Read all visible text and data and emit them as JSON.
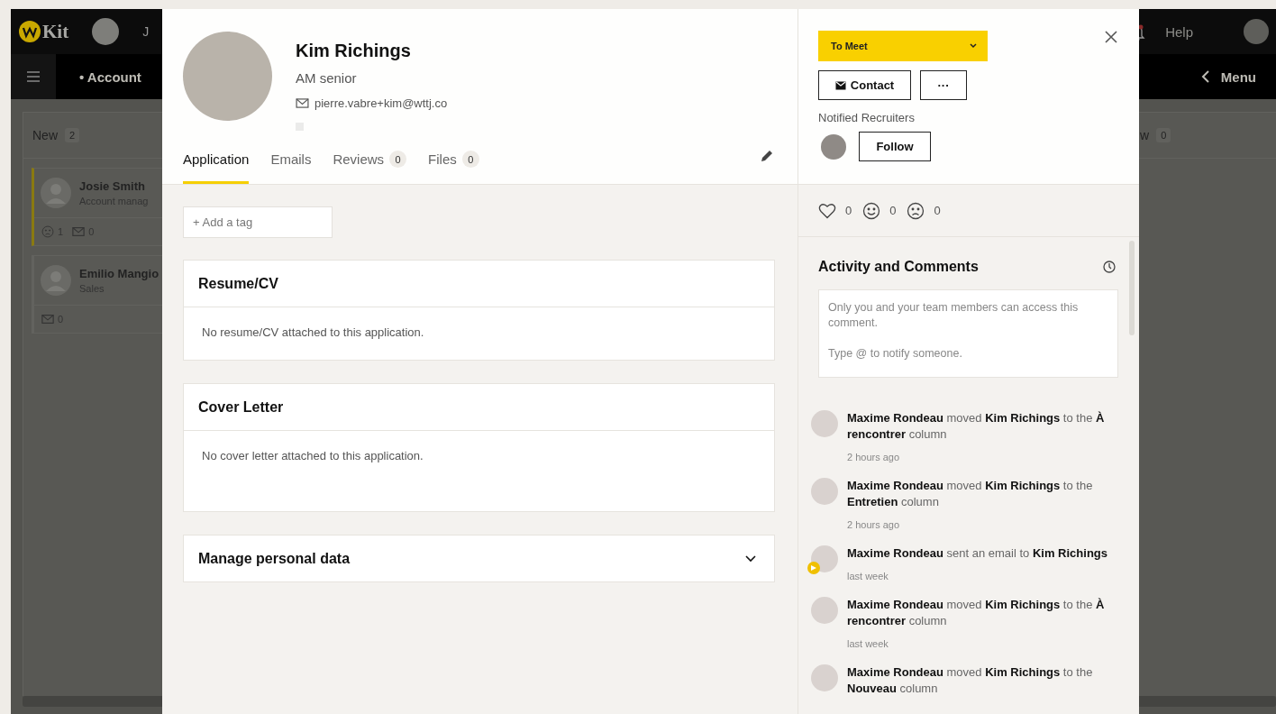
{
  "background_app": {
    "logo": "Kit",
    "nav_partial": "J",
    "help": "Help",
    "section_title": "• Account",
    "menu": "Menu",
    "columns": [
      {
        "title": "New",
        "count": "2",
        "cards": [
          {
            "name": "Josie Smith",
            "role": "Account manag",
            "highlighted": true,
            "stats": [
              {
                "kind": "sad",
                "count": "1"
              },
              {
                "kind": "mail",
                "count": "0"
              }
            ]
          },
          {
            "name": "Emilio Mangio",
            "role": "Sales",
            "highlighted": false,
            "stats": [
              {
                "kind": "mail",
                "count": "0"
              }
            ]
          }
        ]
      },
      {
        "title": "w",
        "count": "0"
      }
    ]
  },
  "candidate": {
    "name": "Kim Richings",
    "role": "AM senior",
    "email": "pierre.vabre+kim@wttj.co"
  },
  "tabs": [
    {
      "label": "Application",
      "selected": true
    },
    {
      "label": "Emails",
      "selected": false
    },
    {
      "label": "Reviews",
      "count": "0",
      "selected": false
    },
    {
      "label": "Files",
      "count": "0",
      "selected": false
    }
  ],
  "tag_field": {
    "placeholder": "+ Add a tag"
  },
  "sections": [
    {
      "kind": "panel",
      "title": "Resume/CV",
      "body": "No resume/CV attached to this application."
    },
    {
      "kind": "panel",
      "title": "Cover Letter",
      "body": "No cover letter attached to this application."
    },
    {
      "kind": "collapsible",
      "title": "Manage personal data",
      "expanded": false
    }
  ],
  "status_dropdown": {
    "value": "To Meet"
  },
  "actions": {
    "contact": "Contact",
    "more": "···"
  },
  "notified_recruiters": {
    "label": "Notified Recruiters",
    "follow": "Follow"
  },
  "reactions": [
    {
      "kind": "heart",
      "count": "0"
    },
    {
      "kind": "smile",
      "count": "0"
    },
    {
      "kind": "sad",
      "count": "0"
    }
  ],
  "activity": {
    "title": "Activity and Comments",
    "comment_placeholder": "Only you and your team members can access this comment.\n\nType @ to notify someone.",
    "items": [
      {
        "kind": "move",
        "text": "**Maxime Rondeau** moved **Kim Richings** to the **À rencontrer** column",
        "time": "2 hours ago"
      },
      {
        "kind": "move",
        "text": "**Maxime Rondeau** moved **Kim Richings** to the **Entretien** column",
        "time": "2 hours ago"
      },
      {
        "kind": "email",
        "text": "**Maxime Rondeau** sent an email to **Kim Richings**",
        "time": "last week"
      },
      {
        "kind": "move",
        "text": "**Maxime Rondeau** moved **Kim Richings** to the **À rencontrer** column",
        "time": "last week"
      },
      {
        "kind": "move",
        "text": "**Maxime Rondeau** moved **Kim Richings** to the **Nouveau** column"
      }
    ]
  }
}
